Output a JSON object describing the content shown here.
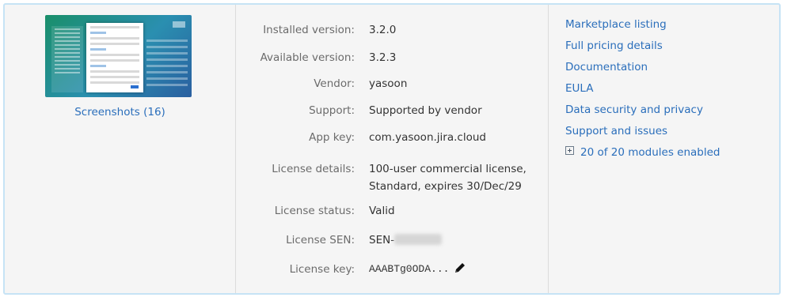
{
  "left": {
    "screenshots_link": "Screenshots (16)"
  },
  "details": {
    "installed_version": {
      "label": "Installed version:",
      "value": "3.2.0"
    },
    "available_version": {
      "label": "Available version:",
      "value": "3.2.3"
    },
    "vendor": {
      "label": "Vendor:",
      "value": "yasoon"
    },
    "support": {
      "label": "Support:",
      "value": "Supported by vendor"
    },
    "app_key": {
      "label": "App key:",
      "value": "com.yasoon.jira.cloud"
    },
    "license_details": {
      "label": "License details:",
      "line1": "100-user commercial license,",
      "line2": "Standard, expires 30/Dec/29"
    },
    "license_status": {
      "label": "License status:",
      "value": "Valid"
    },
    "license_sen": {
      "label": "License SEN:",
      "value": "SEN-"
    },
    "license_key": {
      "label": "License key:",
      "value": "AAABTg0ODA...",
      "edit_icon": "pencil-icon"
    }
  },
  "links": {
    "marketplace": "Marketplace listing",
    "pricing": "Full pricing details",
    "documentation": "Documentation",
    "eula": "EULA",
    "data_security": "Data security and privacy",
    "support_issues": "Support and issues",
    "modules": "20 of 20 modules enabled",
    "modules_icon": "expand-plus-icon"
  },
  "colors": {
    "link": "#2a6ebb",
    "label": "#6b6b6b",
    "panel_border": "#c6e3f5",
    "panel_bg": "#f5f5f5"
  }
}
